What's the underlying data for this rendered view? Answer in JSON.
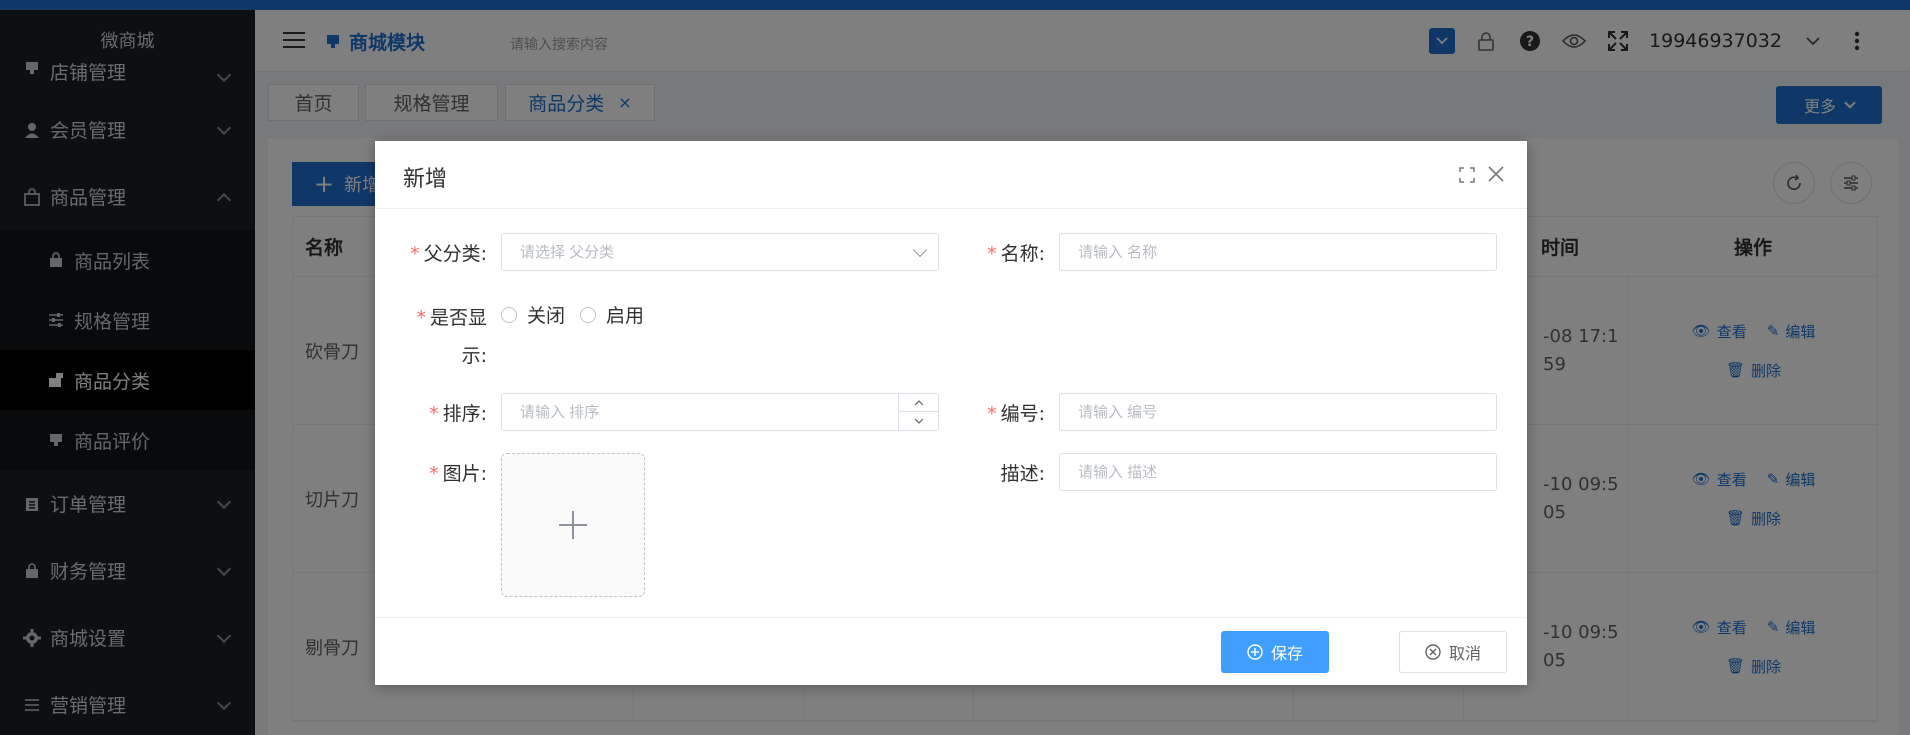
{
  "sidebar": {
    "brand": "微商城",
    "menus": [
      {
        "label": "店铺管理",
        "icon": "store-icon"
      },
      {
        "label": "会员管理",
        "icon": "user-icon"
      },
      {
        "label": "商品管理",
        "icon": "bag-icon"
      }
    ],
    "submenus": [
      {
        "label": "商品列表",
        "icon": "bag-icon"
      },
      {
        "label": "规格管理",
        "icon": "sliders-icon"
      },
      {
        "label": "商品分类",
        "icon": "category-icon"
      },
      {
        "label": "商品评价",
        "icon": "store-icon"
      }
    ],
    "menus_after": [
      {
        "label": "订单管理",
        "icon": "clipboard-icon"
      },
      {
        "label": "财务管理",
        "icon": "bag-icon"
      },
      {
        "label": "商城设置",
        "icon": "gear-icon"
      },
      {
        "label": "营销管理",
        "icon": "sliders-icon"
      }
    ]
  },
  "header": {
    "module": "商城模块",
    "search_placeholder": "请输入搜索内容",
    "user": "19946937032"
  },
  "tabs": [
    {
      "label": "首页"
    },
    {
      "label": "规格管理"
    },
    {
      "label": "商品分类",
      "close": "×"
    }
  ],
  "more_label": "更多",
  "content": {
    "add_label": "新增",
    "columns": {
      "name": "名称",
      "time": "时间",
      "ops": "操作"
    },
    "rows": [
      {
        "name": "砍骨刀",
        "time_1": "-08 17:1",
        "time_2": "59"
      },
      {
        "name": "切片刀",
        "time_1": "-10 09:5",
        "time_2": "05"
      },
      {
        "name": "剔骨刀",
        "time_1": "-10 09:5",
        "time_2": "05"
      }
    ],
    "ops": {
      "view": "查看",
      "edit": "编辑",
      "delete": "删除"
    }
  },
  "dialog": {
    "title": "新增",
    "fields": {
      "parent_label": "父分类:",
      "parent_placeholder": "请选择 父分类",
      "name_label": "名称:",
      "name_placeholder": "请输入 名称",
      "show_label_1": "是否显",
      "show_label_2": "示:",
      "radio_off": "关闭",
      "radio_on": "启用",
      "sort_label": "排序:",
      "sort_placeholder": "请输入 排序",
      "code_label": "编号:",
      "code_placeholder": "请输入 编号",
      "image_label": "图片:",
      "desc_label": "描述:",
      "desc_placeholder": "请输入 描述"
    },
    "save_label": "保存",
    "cancel_label": "取消"
  }
}
